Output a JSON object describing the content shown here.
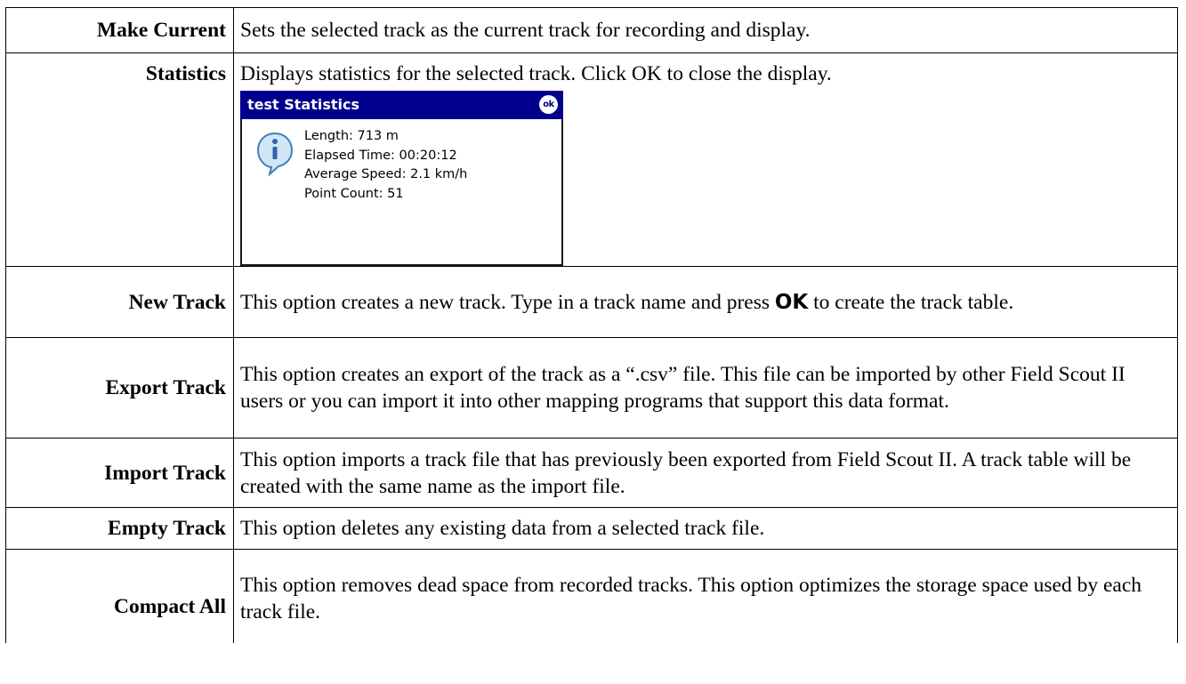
{
  "rows": [
    {
      "label": "Make Current",
      "description": "Sets the selected track as the current track for recording and display."
    },
    {
      "label": "Statistics",
      "description": "Displays statistics for the selected track. Click OK to close the display."
    },
    {
      "label": "New Track",
      "description_before": "This option creates a new track.  Type in a track name and press ",
      "description_bold": "OK",
      "description_after": " to create the track table."
    },
    {
      "label": "Export Track",
      "description": "This option creates an export of the track as a “.csv” file.  This file can be imported by other Field Scout II users or you can import it into other mapping programs that support this data format."
    },
    {
      "label": "Import Track",
      "description": "This option imports a track file that has previously been exported from Field Scout II.  A track table will be created with the same name as the import file."
    },
    {
      "label": "Empty Track",
      "description": "This option deletes any existing data from a selected track file."
    },
    {
      "label": "Compact All",
      "description": "This option removes dead space from recorded tracks.  This option optimizes the storage space used by each track file."
    }
  ],
  "dialog": {
    "title": "test Statistics",
    "ok_button": "ok",
    "icon": "info-icon",
    "lines": [
      "Length: 713 m",
      "Elapsed Time: 00:20:12",
      "Average Speed: 2.1 km/h",
      "Point Count: 51"
    ]
  },
  "colors": {
    "titlebar": "#00008c",
    "icon_fill": "#cfe6f7"
  }
}
